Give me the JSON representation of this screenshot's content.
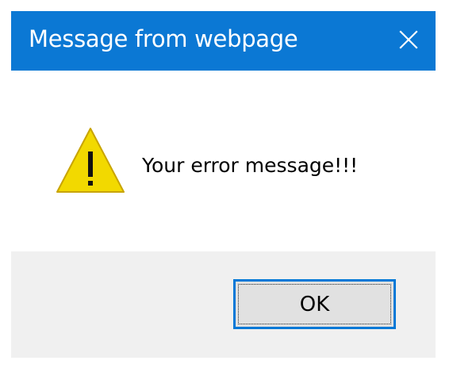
{
  "window": {
    "title": "Message from webpage",
    "close_icon": "close-icon",
    "titlebar_color": "#0b78d4"
  },
  "content": {
    "icon": "warning-icon",
    "message": "Your error message!!!"
  },
  "footer": {
    "ok_label": "OK",
    "button_border_color": "#0078d7"
  }
}
